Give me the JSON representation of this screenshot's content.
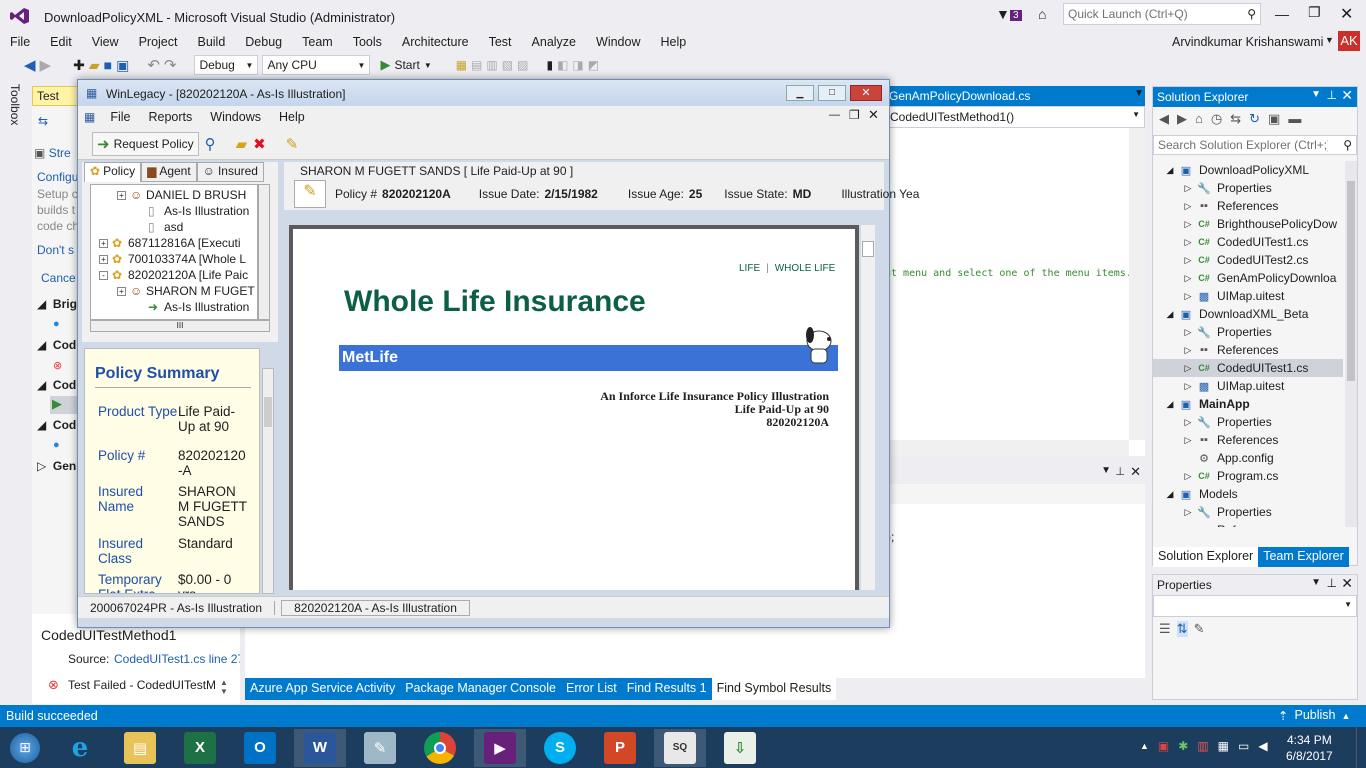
{
  "window": {
    "title": "DownloadPolicyXML - Microsoft Visual Studio (Administrator)",
    "notification_count": "3",
    "quick_launch_placeholder": "Quick Launch (Ctrl+Q)",
    "user_name": "Arvindkumar Krishanswami",
    "user_initials": "AK"
  },
  "menu": [
    "File",
    "Edit",
    "View",
    "Project",
    "Build",
    "Debug",
    "Team",
    "Tools",
    "Architecture",
    "Test",
    "Analyze",
    "Window",
    "Help"
  ],
  "toolbar": {
    "config": "Debug",
    "platform": "Any CPU",
    "start": "Start"
  },
  "side_tab": "Toolbox",
  "test_explorer": {
    "tab": "Test Exp",
    "items": [
      "Stre",
      "Configu",
      "Setup c",
      "builds t",
      "code ch",
      "Don't s",
      "Cance",
      "Brig",
      "Cod",
      "Cod",
      "Cod",
      "Gen"
    ],
    "detail_title": "CodedUITestMethod1",
    "source_label": "Source:",
    "source_link": "CodedUITest1.cs line 27",
    "failed_text": "Test Failed - CodedUITestM"
  },
  "editor": {
    "tab": "GenAmPolicyDownload.cs",
    "method_combo": "CodedUITestMethod1()",
    "code_comment": "ut menu and select one of the menu items.",
    "output_snippet": ");"
  },
  "bottom_tabs": [
    "Azure App Service Activity",
    "Package Manager Console",
    "Error List",
    "Find Results 1",
    "Find Symbol Results"
  ],
  "solution_explorer": {
    "title": "Solution Explorer",
    "search_placeholder": "Search Solution Explorer (Ctrl+;)",
    "items": [
      {
        "label": "DownloadPolicyXML",
        "icon": "project-icon",
        "indent": 0
      },
      {
        "label": "Properties",
        "icon": "wrench-icon",
        "indent": 1
      },
      {
        "label": "References",
        "icon": "references-icon",
        "indent": 1
      },
      {
        "label": "BrighthousePolicyDow",
        "icon": "csharp-icon",
        "indent": 1
      },
      {
        "label": "CodedUITest1.cs",
        "icon": "csharp-icon",
        "indent": 1
      },
      {
        "label": "CodedUITest2.cs",
        "icon": "csharp-icon",
        "indent": 1
      },
      {
        "label": "GenAmPolicyDownloa",
        "icon": "csharp-icon",
        "indent": 1
      },
      {
        "label": "UIMap.uitest",
        "icon": "uimap-icon",
        "indent": 1
      },
      {
        "label": "DownloadXML_Beta",
        "icon": "project-icon",
        "indent": 0
      },
      {
        "label": "Properties",
        "icon": "wrench-icon",
        "indent": 1
      },
      {
        "label": "References",
        "icon": "references-icon",
        "indent": 1
      },
      {
        "label": "CodedUITest1.cs",
        "icon": "csharp-icon",
        "indent": 1
      },
      {
        "label": "UIMap.uitest",
        "icon": "uimap-icon",
        "indent": 1
      },
      {
        "label": "MainApp",
        "icon": "project-icon",
        "indent": 0
      },
      {
        "label": "Properties",
        "icon": "wrench-icon",
        "indent": 1
      },
      {
        "label": "References",
        "icon": "references-icon",
        "indent": 1
      },
      {
        "label": "App.config",
        "icon": "config-icon",
        "indent": 1
      },
      {
        "label": "Program.cs",
        "icon": "csharp-icon",
        "indent": 1
      },
      {
        "label": "Models",
        "icon": "project-icon",
        "indent": 0
      },
      {
        "label": "Properties",
        "icon": "wrench-icon",
        "indent": 1
      },
      {
        "label": "References",
        "icon": "references-icon",
        "indent": 1
      }
    ],
    "tabs": [
      "Solution Explorer",
      "Team Explorer"
    ],
    "properties_title": "Properties"
  },
  "winlegacy": {
    "title": "WinLegacy - [820202120A    - As-Is Illustration]",
    "menu": [
      "File",
      "Reports",
      "Windows",
      "Help"
    ],
    "request_policy": "Request Policy",
    "panel_tabs": [
      "Policy",
      "Agent",
      "Insured"
    ],
    "tree": [
      {
        "label": "DANIEL D BRUSH",
        "level": 2,
        "expander": "+"
      },
      {
        "label": "As-Is Illustration",
        "level": 3,
        "expander": ""
      },
      {
        "label": "asd",
        "level": 3,
        "expander": ""
      },
      {
        "label": "687112816A    [Executi",
        "level": 1,
        "expander": "+"
      },
      {
        "label": "700103374A    [Whole L",
        "level": 1,
        "expander": "+"
      },
      {
        "label": "820202120A    [Life Paic",
        "level": 1,
        "expander": "-"
      },
      {
        "label": "SHARON M FUGET",
        "level": 2,
        "expander": "+"
      },
      {
        "label": "As-Is Illustration",
        "level": 3,
        "expander": ""
      }
    ],
    "summary": {
      "title": "Policy Summary",
      "rows": [
        {
          "label": "Product Type",
          "value": "Life Paid-Up at 90"
        },
        {
          "label": "Policy #",
          "value": "820202120-A"
        },
        {
          "label": "Insured Name",
          "value": "SHARON M FUGETT SANDS"
        },
        {
          "label": "Insured Class",
          "value": "Standard"
        },
        {
          "label": "Temporary Flat Extra",
          "value": "$0.00 - 0 yrs"
        }
      ]
    },
    "header_name": "SHARON M FUGETT SANDS  [ Life Paid-Up at 90 ]",
    "policy_label": "Policy #",
    "policy_value": "820202120A",
    "issue_date_label": "Issue Date:",
    "issue_date_value": "2/15/1982",
    "issue_age_label": "Issue Age:",
    "issue_age_value": "25",
    "issue_state_label": "Issue State:",
    "issue_state_value": "MD",
    "illustration_year_label": "Illustration Yea",
    "doc": {
      "brand_tag_left": "LIFE",
      "brand_tag_sep": "|",
      "brand_tag_right": "WHOLE LIFE",
      "heading": "Whole Life Insurance",
      "brand": "MetLife",
      "line1": "An Inforce Life Insurance Policy Illustration",
      "line2": "Life Paid-Up at 90",
      "line3": "820202120A"
    },
    "status_left": "200067024PR    - As-Is Illustration",
    "status_right": "820202120A    - As-Is Illustration"
  },
  "statusbar": {
    "left": "Build succeeded",
    "publish": "Publish"
  },
  "taskbar": {
    "time": "4:34 PM",
    "date": "6/8/2017"
  },
  "colors": {
    "vs_blue": "#007acc",
    "taskbar": "#1c3d5e",
    "metlife_bar": "#3a73d5",
    "heading_green": "#0d5e47",
    "summary_bg": "#fffde6"
  }
}
